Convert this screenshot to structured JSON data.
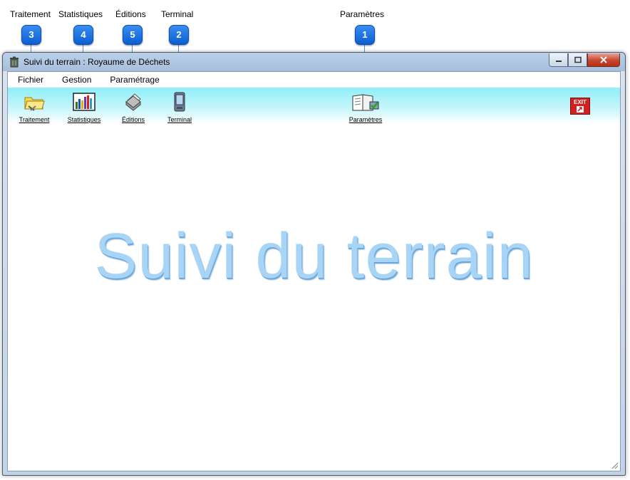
{
  "callouts": [
    {
      "label": "Traitement",
      "number": "3"
    },
    {
      "label": "Statistiques",
      "number": "4"
    },
    {
      "label": "Éditions",
      "number": "5"
    },
    {
      "label": "Terminal",
      "number": "2"
    },
    {
      "label": "Paramètres",
      "number": "1"
    }
  ],
  "window": {
    "title": "Suivi du terrain : Royaume de Déchets"
  },
  "menu": [
    {
      "label": "Fichier"
    },
    {
      "label": "Gestion"
    },
    {
      "label": "Paramétrage"
    }
  ],
  "toolbar": {
    "traitement": "Traitement",
    "statistiques": "Statistiques",
    "editions": "Éditions",
    "terminal": "Terminal",
    "parametres": "Paramètres",
    "exit": "EXIT"
  },
  "main": {
    "banner": "Suivi du terrain"
  },
  "colors": {
    "badge": "#0b5ed3",
    "toolbar": "#8feef8",
    "banner": "#a8d4f6",
    "exit": "#d41f1f"
  }
}
